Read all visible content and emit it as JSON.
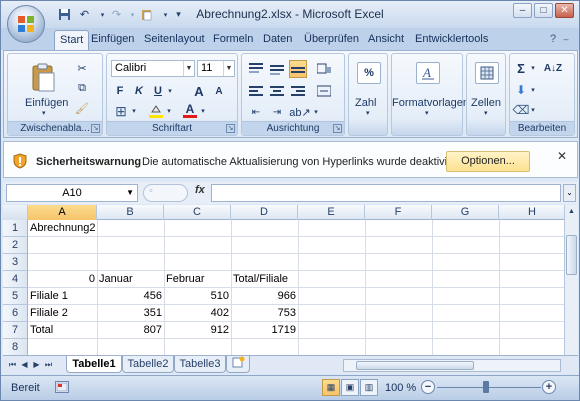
{
  "window": {
    "title": "Abrechnung2.xlsx - Microsoft Excel",
    "buttons": {
      "minimize": "–",
      "maximize": "□",
      "close": "✕"
    }
  },
  "quick_access": {
    "save_icon": "save-icon",
    "undo_icon": "undo-icon",
    "redo_icon": "redo-icon",
    "paste_icon": "paste-icon",
    "customize": "▾"
  },
  "tabs": [
    {
      "label": "Start",
      "active": true
    },
    {
      "label": "Einfügen"
    },
    {
      "label": "Seitenlayout"
    },
    {
      "label": "Formeln"
    },
    {
      "label": "Daten"
    },
    {
      "label": "Überprüfen"
    },
    {
      "label": "Ansicht"
    },
    {
      "label": "Entwicklertools"
    }
  ],
  "ribbon": {
    "groups": {
      "clipboard": "Zwischenabla...",
      "font": "Schriftart",
      "alignment": "Ausrichtung",
      "number": "Zahl",
      "styles": "Formatvorlagen",
      "cells": "Zellen",
      "editing": "Bearbeiten"
    },
    "paste_label": "Einfügen",
    "font_name": "Calibri",
    "font_size": "11",
    "bold": "F",
    "italic": "K",
    "underline": "U",
    "grow_font": "A",
    "shrink_font": "A",
    "font_color_letter": "A",
    "number_label": "Zahl",
    "percent": "%",
    "styles_label": "Formatvorlagen",
    "cells_label": "Zellen",
    "sum": "Σ",
    "sort": "A↓Z"
  },
  "security_bar": {
    "title": "Sicherheitswarnung",
    "message": "Die automatische Aktualisierung von Hyperlinks wurde deaktiviert.",
    "options_button": "Optionen...",
    "close": "✕"
  },
  "formula_bar": {
    "name_box": "A10",
    "fx": "fx",
    "formula": ""
  },
  "sheet": {
    "columns": [
      "A",
      "B",
      "C",
      "D",
      "E",
      "F",
      "G",
      "H"
    ],
    "rows": [
      "1",
      "2",
      "3",
      "4",
      "5",
      "6",
      "7",
      "8"
    ],
    "selected_column": "A",
    "cells": {
      "A1": "Abrechnung2",
      "A4": "0",
      "B4": "Januar",
      "C4": "Februar",
      "D4": "Total/Filiale",
      "A5": "Filiale 1",
      "B5": "456",
      "C5": "510",
      "D5": "966",
      "A6": "Filiale 2",
      "B6": "351",
      "C6": "402",
      "D6": "753",
      "A7": "Total",
      "B7": "807",
      "C7": "912",
      "D7": "1719"
    }
  },
  "sheet_tabs": [
    {
      "label": "Tabelle1",
      "active": true
    },
    {
      "label": "Tabelle2"
    },
    {
      "label": "Tabelle3"
    }
  ],
  "status": {
    "ready": "Bereit",
    "zoom": "100 %",
    "zoom_level": 1.0,
    "zoom_out": "−",
    "zoom_in": "+"
  },
  "colors": {
    "accent": "#f7c36b",
    "ribbon_bg": "#dde8f5",
    "tab_text": "#15305a"
  }
}
